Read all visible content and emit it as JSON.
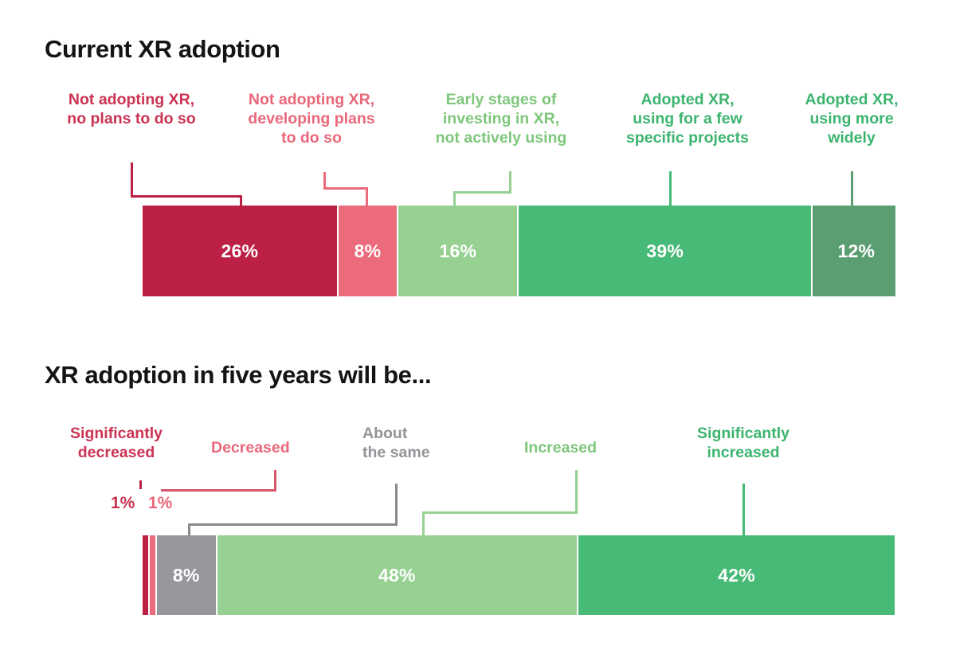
{
  "charts": [
    {
      "title": "Current XR adoption",
      "labels": [
        "Not adopting XR,\nno plans to do so",
        "Not adopting XR,\ndeveloping plans\nto do so",
        "Early stages of\ninvesting in XR,\nnot actively using",
        "Adopted XR,\nusing for a few\nspecific projects",
        "Adopted XR,\nusing more\nwidely"
      ],
      "values": [
        "26%",
        "8%",
        "16%",
        "39%",
        "12%"
      ]
    },
    {
      "title": "XR adoption in five years will be...",
      "labels": [
        "Significantly\ndecreased",
        "Decreased",
        "About\nthe same",
        "Increased",
        "Significantly\nincreased"
      ],
      "values": [
        "1%",
        "1%",
        "8%",
        "48%",
        "42%"
      ],
      "tiny_pct": [
        "1%",
        "1%"
      ]
    }
  ],
  "chart_data": [
    {
      "type": "bar",
      "orientation": "horizontal-stacked",
      "title": "Current XR adoption",
      "xlabel": "",
      "ylabel": "",
      "xlim": [
        0,
        101
      ],
      "grid": false,
      "legend": "callout-labels-above-bar",
      "categories": [
        "Not adopting XR, no plans to do so",
        "Not adopting XR, developing plans to do so",
        "Early stages of investing in XR, not actively using",
        "Adopted XR, using for a few specific projects",
        "Adopted XR, using more widely"
      ],
      "values": [
        26,
        8,
        16,
        39,
        12
      ],
      "value_labels": [
        "26%",
        "8%",
        "16%",
        "39%",
        "12%"
      ],
      "colors": [
        "#bc2044",
        "#eb6b7c",
        "#96d192",
        "#46ba76",
        "#5a9e72"
      ],
      "label_colors": [
        "#cb3352",
        "#e8687a",
        "#7ec77c",
        "#3cb46f",
        "#3cb46f"
      ]
    },
    {
      "type": "bar",
      "orientation": "horizontal-stacked",
      "title": "XR adoption in five years will be...",
      "xlabel": "",
      "ylabel": "",
      "xlim": [
        0,
        100
      ],
      "grid": false,
      "legend": "callout-labels-above-bar",
      "categories": [
        "Significantly decreased",
        "Decreased",
        "About the same",
        "Increased",
        "Significantly increased"
      ],
      "values": [
        1,
        1,
        8,
        48,
        42
      ],
      "value_labels": [
        "1%",
        "1%",
        "8%",
        "48%",
        "42%"
      ],
      "colors": [
        "#bc2044",
        "#eb6b7c",
        "#96979c",
        "#96d192",
        "#46ba76"
      ],
      "label_colors": [
        "#cb3352",
        "#e8687a",
        "#929498",
        "#7ec77c",
        "#3cb46f"
      ]
    }
  ],
  "palette": {
    "crimson": "#bc2044",
    "pink": "#eb6b7c",
    "light_green": "#96d192",
    "green": "#46ba76",
    "dark_green": "#5a9e72",
    "gray": "#96979c",
    "label_red_dark": "#cb3352",
    "label_red_light": "#e8687a",
    "label_green_light": "#7ec77c",
    "label_green": "#3cb46f",
    "label_gray": "#929498",
    "title_black": "#141414",
    "background": "#ffffff"
  }
}
